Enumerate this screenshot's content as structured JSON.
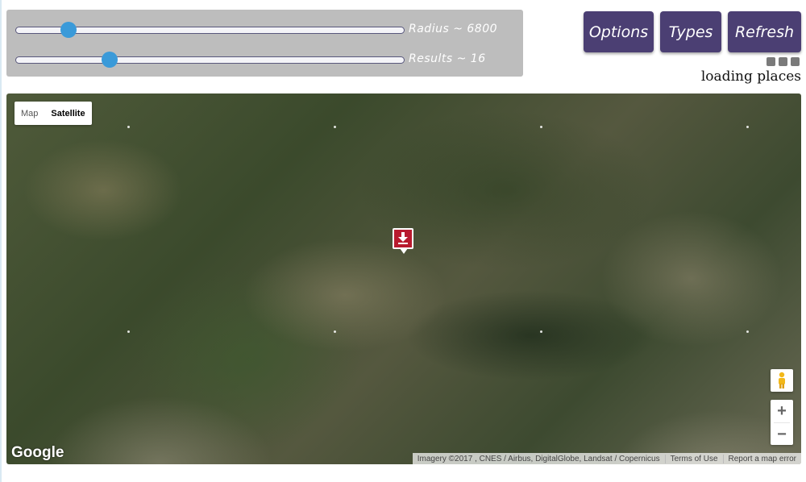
{
  "sliders": {
    "radius": {
      "label": "Radius ~ 6800",
      "value_fraction": 0.135
    },
    "results": {
      "label": "Results ~ 16",
      "value_fraction": 0.24
    }
  },
  "buttons": {
    "options": "Options",
    "types": "Types",
    "refresh": "Refresh"
  },
  "status": {
    "loading_text": "loading places"
  },
  "map": {
    "type_control": {
      "map_label": "Map",
      "satellite_label": "Satellite",
      "selected": "Satellite"
    },
    "zoom_in_label": "+",
    "zoom_out_label": "−",
    "logo_text": "Google",
    "attribution": {
      "imagery": "Imagery ©2017 , CNES / Airbus, DigitalGlobe, Landsat / Copernicus",
      "terms": "Terms of Use",
      "report": "Report a map error"
    }
  },
  "colors": {
    "button_bg": "#4b3f73",
    "slider_thumb": "#3a9ad9",
    "panel_bg": "#bdbdbd",
    "marker": "#b81a2e"
  }
}
